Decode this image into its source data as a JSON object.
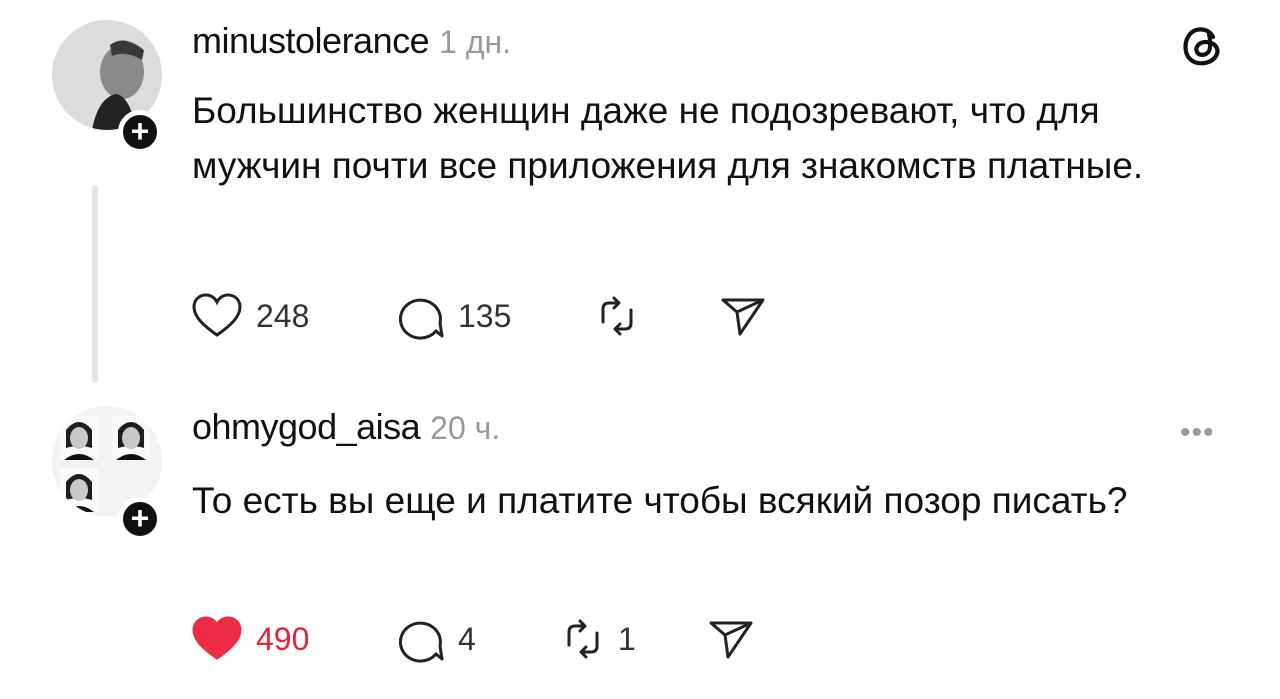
{
  "posts": [
    {
      "username": "minustolerance",
      "time": "1 дн.",
      "text": "Большинство женщин даже не подозревают, что для мужчин почти все приложения для знакомств платные.",
      "likes": "248",
      "replies": "135",
      "reposts": "",
      "liked": false,
      "top_right_icon": "threads-logo-icon"
    },
    {
      "username": "ohmygod_aisa",
      "time": "20 ч.",
      "text": "То есть вы еще и платите чтобы всякий позор писать?",
      "likes": "490",
      "replies": "4",
      "reposts": "1",
      "liked": true,
      "top_right_icon": "more-options-icon",
      "more_label": "•••"
    }
  ],
  "badge_symbol": "+",
  "colors": {
    "like_active": "#ed2b46",
    "muted": "#9a9a9a",
    "text": "#111111"
  }
}
